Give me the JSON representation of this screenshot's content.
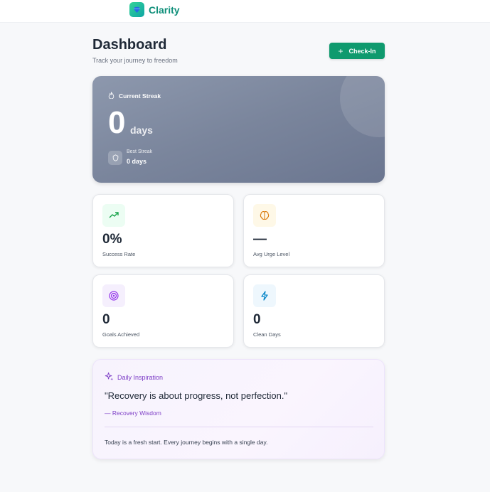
{
  "app": {
    "name": "Clarity",
    "logo_icon": "gem-icon",
    "accent": "#0f9a6e"
  },
  "header": {
    "title": "Dashboard",
    "subtitle": "Track your journey to freedom",
    "checkin": {
      "label": "Check-In",
      "icon": "plus-icon"
    }
  },
  "streak": {
    "label": "Current Streak",
    "icon": "flame-icon",
    "value": "0",
    "unit": "days",
    "best_label": "Best Streak",
    "best_value": "0 days",
    "best_icon": "shield-icon"
  },
  "stats": [
    {
      "value": "0%",
      "label": "Success Rate",
      "icon": "trending-up-icon",
      "color": "#16a34a",
      "bg": "#ecfdf3"
    },
    {
      "value": "—",
      "label": "Avg Urge Level",
      "icon": "brain-icon",
      "color": "#d97706",
      "bg": "#fef8e7"
    },
    {
      "value": "0",
      "label": "Goals Achieved",
      "icon": "target-icon",
      "color": "#9333ea",
      "bg": "#f5effd"
    },
    {
      "value": "0",
      "label": "Clean Days",
      "icon": "lightning-icon",
      "color": "#0284c7",
      "bg": "#eef7fd"
    }
  ],
  "inspiration": {
    "title": "Daily Inspiration",
    "icon": "sparkles-icon",
    "quote": "\"Recovery is about progress, not perfection.\"",
    "author": "— Recovery Wisdom",
    "note": "Today is a fresh start. Every journey begins with a single day."
  }
}
